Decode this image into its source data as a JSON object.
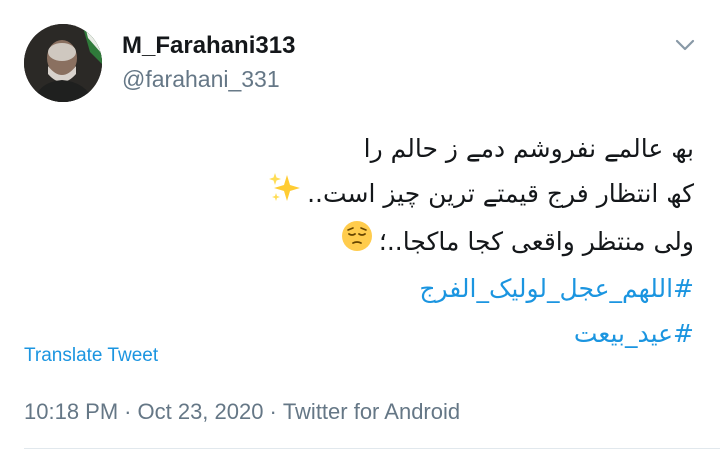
{
  "user": {
    "display_name": "M_Farahani313",
    "handle": "@farahani_331",
    "avatar_icon": "avatar"
  },
  "tweet": {
    "lines": [
      "بھ عالمے نفروشم دمے ز حالم را",
      "کھ انتظار فرج قیمتے ترین چیز است..",
      "ولی منتظر واقعی کجا ماکجا..؛"
    ],
    "hashtags": [
      "#اللهم_عجل_لولیک_الفرج",
      "#عید_بیعت"
    ],
    "emojis": [
      "sparkles-icon",
      "pensive-face-icon"
    ]
  },
  "actions": {
    "translate_label": "Translate Tweet",
    "caret_icon": "chevron-down-icon"
  },
  "meta": {
    "time": "10:18 PM",
    "date": "Oct 23, 2020",
    "source": "Twitter for Android",
    "separator": "·"
  },
  "colors": {
    "link": "#1b95e0",
    "text": "#14171a",
    "secondary": "#657786",
    "divider": "#e1e8ed"
  }
}
